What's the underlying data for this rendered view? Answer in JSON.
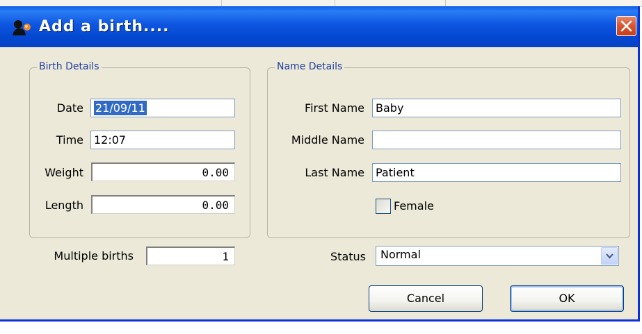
{
  "dialog": {
    "title": "Add a birth....",
    "close_icon": "close-x-icon"
  },
  "birth_details": {
    "legend": "Birth Details",
    "date_label": "Date",
    "date_value": "21/09/11",
    "time_label": "Time",
    "time_value": "12:07",
    "weight_label": "Weight",
    "weight_value": "0.00",
    "length_label": "Length",
    "length_value": "0.00"
  },
  "multiple_births": {
    "label": "Multiple births",
    "value": "1"
  },
  "name_details": {
    "legend": "Name Details",
    "first_name_label": "First Name",
    "first_name_value": "Baby",
    "middle_name_label": "Middle Name",
    "middle_name_value": "",
    "last_name_label": "Last Name",
    "last_name_value": "Patient",
    "female_label": "Female",
    "female_checked": false
  },
  "status": {
    "label": "Status",
    "value": "Normal"
  },
  "buttons": {
    "cancel": "Cancel",
    "ok": "OK"
  },
  "colors": {
    "titlebar": "#0a5fe9",
    "dialog_bg": "#ece9d8",
    "legend_text": "#1f3f9f",
    "selection": "#316ac5",
    "close_button": "#d8532d"
  }
}
